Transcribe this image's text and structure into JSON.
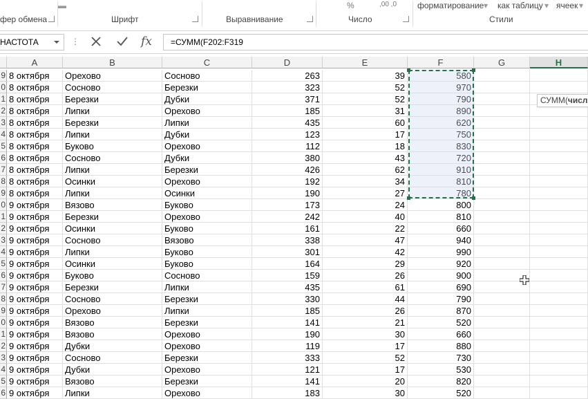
{
  "ribbon": {
    "groups": {
      "clipboard": "фер обмена",
      "font": "Шрифт",
      "alignment": "Выравнивание",
      "number": "Число",
      "styles": "Стили"
    },
    "top_items": {
      "conditional_format": "форматирование",
      "format_as_table": "как таблицу",
      "cell_styles": "ячеек",
      "percent_icon": "%",
      "decimal_icon": ",00 ,0"
    }
  },
  "formula_bar": {
    "name_box": "НАСТОТА",
    "formula": "=СУММ(F202:F319"
  },
  "tooltip": {
    "func": "СУММ(",
    "arg": "числ"
  },
  "columns": [
    "A",
    "B",
    "C",
    "D",
    "E",
    "F",
    "G",
    "H"
  ],
  "rows": [
    {
      "rn": "9",
      "a": "8 октября",
      "b": "Орехово",
      "c": "Сосново",
      "d": "263",
      "e": "39",
      "f": "580"
    },
    {
      "rn": "0",
      "a": "8 октября",
      "b": "Сосново",
      "c": "Березки",
      "d": "323",
      "e": "52",
      "f": "970"
    },
    {
      "rn": "1",
      "a": "8 октября",
      "b": "Березки",
      "c": "Дубки",
      "d": "371",
      "e": "52",
      "f": "790"
    },
    {
      "rn": "2",
      "a": "8 октября",
      "b": "Липки",
      "c": "Орехово",
      "d": "185",
      "e": "31",
      "f": "890"
    },
    {
      "rn": "3",
      "a": "8 октября",
      "b": "Березки",
      "c": "Липки",
      "d": "435",
      "e": "60",
      "f": "620"
    },
    {
      "rn": "4",
      "a": "8 октября",
      "b": "Липки",
      "c": "Дубки",
      "d": "123",
      "e": "17",
      "f": "750"
    },
    {
      "rn": "5",
      "a": "8 октября",
      "b": "Буково",
      "c": "Орехово",
      "d": "112",
      "e": "18",
      "f": "830"
    },
    {
      "rn": "6",
      "a": "8 октября",
      "b": "Сосново",
      "c": "Дубки",
      "d": "380",
      "e": "43",
      "f": "720"
    },
    {
      "rn": "7",
      "a": "8 октября",
      "b": "Липки",
      "c": "Березки",
      "d": "426",
      "e": "62",
      "f": "910"
    },
    {
      "rn": "8",
      "a": "8 октября",
      "b": "Осинки",
      "c": "Орехово",
      "d": "192",
      "e": "34",
      "f": "810"
    },
    {
      "rn": "9",
      "a": "8 октября",
      "b": "Липки",
      "c": "Осинки",
      "d": "190",
      "e": "27",
      "f": "780"
    },
    {
      "rn": "0",
      "a": "9 октября",
      "b": "Вязово",
      "c": "Буково",
      "d": "173",
      "e": "24",
      "f": "800"
    },
    {
      "rn": "1",
      "a": "9 октября",
      "b": "Березки",
      "c": "Орехово",
      "d": "242",
      "e": "40",
      "f": "810"
    },
    {
      "rn": "2",
      "a": "9 октября",
      "b": "Осинки",
      "c": "Буково",
      "d": "161",
      "e": "22",
      "f": "660"
    },
    {
      "rn": "3",
      "a": "9 октября",
      "b": "Сосново",
      "c": "Вязово",
      "d": "338",
      "e": "47",
      "f": "940"
    },
    {
      "rn": "4",
      "a": "9 октября",
      "b": "Липки",
      "c": "Буково",
      "d": "301",
      "e": "42",
      "f": "990"
    },
    {
      "rn": "5",
      "a": "9 октября",
      "b": "Осинки",
      "c": "Буково",
      "d": "164",
      "e": "29",
      "f": "920"
    },
    {
      "rn": "6",
      "a": "9 октября",
      "b": "Буково",
      "c": "Сосново",
      "d": "159",
      "e": "26",
      "f": "900"
    },
    {
      "rn": "7",
      "a": "9 октября",
      "b": "Березки",
      "c": "Липки",
      "d": "435",
      "e": "61",
      "f": "690"
    },
    {
      "rn": "8",
      "a": "9 октября",
      "b": "Сосново",
      "c": "Березки",
      "d": "330",
      "e": "44",
      "f": "790"
    },
    {
      "rn": "9",
      "a": "9 октября",
      "b": "Орехово",
      "c": "Липки",
      "d": "185",
      "e": "26",
      "f": "870"
    },
    {
      "rn": "0",
      "a": "9 октября",
      "b": "Вязово",
      "c": "Березки",
      "d": "141",
      "e": "21",
      "f": "520"
    },
    {
      "rn": "1",
      "a": "9 октября",
      "b": "Вязово",
      "c": "Орехово",
      "d": "190",
      "e": "30",
      "f": "660"
    },
    {
      "rn": "2",
      "a": "9 октября",
      "b": "Дубки",
      "c": "Орехово",
      "d": "119",
      "e": "17",
      "f": "880"
    },
    {
      "rn": "3",
      "a": "9 октября",
      "b": "Сосново",
      "c": "Березки",
      "d": "333",
      "e": "52",
      "f": "730"
    },
    {
      "rn": "4",
      "a": "9 октября",
      "b": "Дубки",
      "c": "Орехово",
      "d": "121",
      "e": "17",
      "f": "530"
    },
    {
      "rn": "5",
      "a": "9 октября",
      "b": "Вязово",
      "c": "Березки",
      "d": "141",
      "e": "20",
      "f": "820"
    },
    {
      "rn": "6",
      "a": "9 октября",
      "b": "Липки",
      "c": "Орехово",
      "d": "183",
      "e": "30",
      "f": "520"
    }
  ],
  "colors": {
    "accent": "#217346",
    "selection": "#c8d6f0"
  }
}
